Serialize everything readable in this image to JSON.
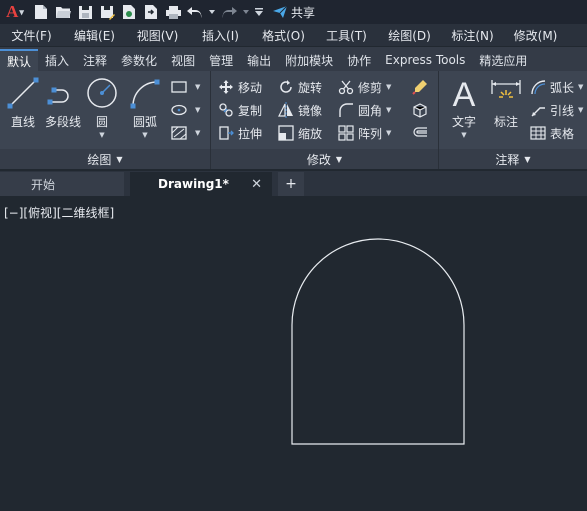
{
  "qat": {
    "share_label": "共享"
  },
  "menu": [
    "文件(F)",
    "编辑(E)",
    "视图(V)",
    "插入(I)",
    "格式(O)",
    "工具(T)",
    "绘图(D)",
    "标注(N)",
    "修改(M)"
  ],
  "ribbon_tabs": [
    "默认",
    "插入",
    "注释",
    "参数化",
    "视图",
    "管理",
    "输出",
    "附加模块",
    "协作",
    "Express Tools",
    "精选应用"
  ],
  "ribbon_active_tab": "默认",
  "draw_panel": {
    "title": "绘图",
    "line": "直线",
    "polyline": "多段线",
    "circle": "圆",
    "arc": "圆弧"
  },
  "modify_panel": {
    "title": "修改",
    "move": "移动",
    "rotate": "旋转",
    "trim": "修剪",
    "copy": "复制",
    "mirror": "镜像",
    "fillet": "圆角",
    "stretch": "拉伸",
    "scale": "缩放",
    "array": "阵列"
  },
  "annotation_panel": {
    "title": "注释",
    "text": "文字",
    "dimension": "标注",
    "arc_length": "弧长",
    "leader": "引线",
    "table": "表格"
  },
  "file_tabs": {
    "start": "开始",
    "drawing": "Drawing1*"
  },
  "viewport_label": "[−][俯视][二维线框]",
  "colors": {
    "accent": "#4c8fd6",
    "logo_red": "#e8413f",
    "canvas_bg": "#212830",
    "geometry": "#e8ecf0"
  }
}
